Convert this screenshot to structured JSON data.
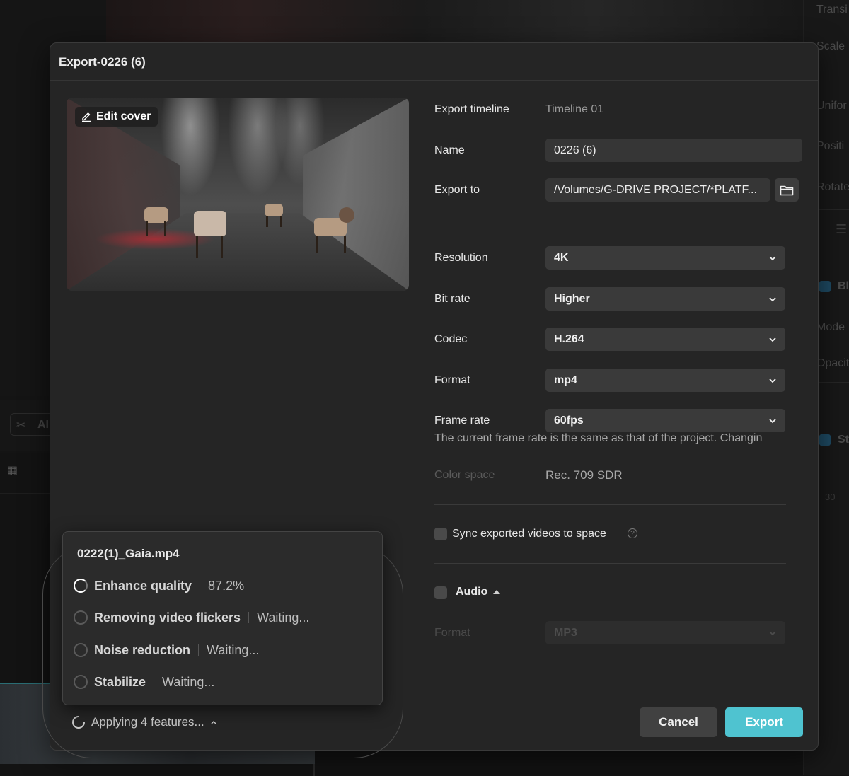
{
  "dialog": {
    "title": "Export-0226 (6)",
    "edit_cover_label": "Edit cover",
    "export_timeline_label": "Export timeline",
    "export_timeline_value": "Timeline 01",
    "name_label": "Name",
    "name_value": "0226 (6)",
    "export_to_label": "Export to",
    "export_to_value": "/Volumes/G-DRIVE PROJECT/*PLATF...",
    "resolution_label": "Resolution",
    "resolution_value": "4K",
    "bitrate_label": "Bit rate",
    "bitrate_value": "Higher",
    "codec_label": "Codec",
    "codec_value": "H.264",
    "format_label": "Format",
    "format_value": "mp4",
    "framerate_label": "Frame rate",
    "framerate_value": "60fps",
    "framerate_hint": "The current frame rate is the same as that of the project. Changin",
    "colorspace_label": "Color space",
    "colorspace_value": "Rec. 709 SDR",
    "sync_label": "Sync exported videos to space",
    "audio_label": "Audio",
    "audio_format_label": "Format",
    "audio_format_value": "MP3",
    "cancel_label": "Cancel",
    "export_label": "Export",
    "applying_label": "Applying 4 features..."
  },
  "popup": {
    "file_name": "0222(1)_Gaia.mp4",
    "tasks": [
      {
        "name": "Enhance quality",
        "status": "87.2%"
      },
      {
        "name": "Removing video flickers",
        "status": "Waiting..."
      },
      {
        "name": "Noise reduction",
        "status": "Waiting..."
      },
      {
        "name": "Stabilize",
        "status": "Waiting..."
      }
    ]
  },
  "background": {
    "right_panel": [
      "Transi",
      "Scale",
      "Unifor",
      "Positi",
      "Rotate",
      "Bl",
      "Mode",
      "Opacit",
      "St",
      "30"
    ],
    "toolbar_label": "AI"
  },
  "colors": {
    "accent": "#4fc3d0",
    "modal_bg": "#252525",
    "input_bg": "#3a3a3a"
  }
}
